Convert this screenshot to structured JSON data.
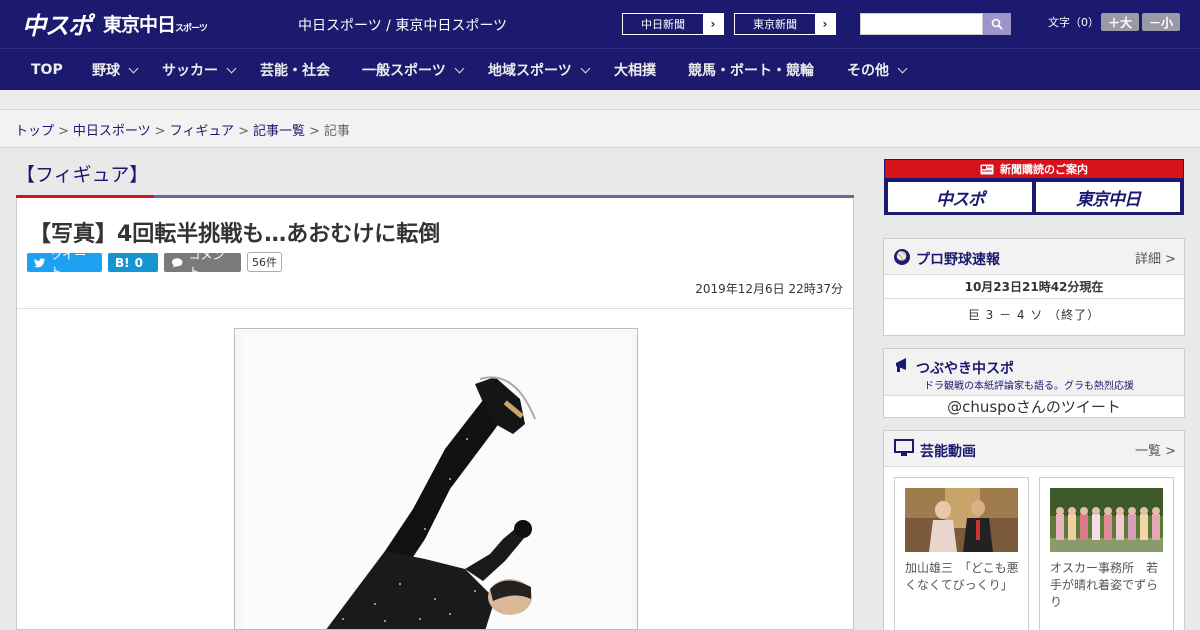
{
  "header": {
    "logo_chuspo": "中スポ",
    "logo_tokyo": "東京中日",
    "logo_tokyo_small": "スポーツ",
    "site_title": "中日スポーツ / 東京中日スポーツ",
    "paper_links": [
      {
        "label": "中日新聞",
        "arrow": "›"
      },
      {
        "label": "東京新聞",
        "arrow": "›"
      }
    ],
    "search_placeholder": "",
    "font_size_label": "文字（0）",
    "font_bigger": "＋大",
    "font_smaller": "－小"
  },
  "nav": [
    {
      "label": "TOP",
      "has_menu": false
    },
    {
      "label": "野球",
      "has_menu": true
    },
    {
      "label": "サッカー",
      "has_menu": true
    },
    {
      "label": "芸能・社会",
      "has_menu": false
    },
    {
      "label": "一般スポーツ",
      "has_menu": true
    },
    {
      "label": "地域スポーツ",
      "has_menu": true
    },
    {
      "label": "大相撲",
      "has_menu": false
    },
    {
      "label": "競馬・ボート・競輪",
      "has_menu": false
    },
    {
      "label": "その他",
      "has_menu": true
    }
  ],
  "breadcrumb": {
    "items": [
      "トップ",
      "中日スポーツ",
      "フィギュア",
      "記事一覧"
    ],
    "current": "記事",
    "separator": ">"
  },
  "category": "【フィギュア】",
  "article": {
    "title": "【写真】4回転半挑戦も…あおむけに転倒",
    "tweet_label": "ツイート",
    "hatena_label": "B!",
    "hatena_count": "0",
    "comment_label": "コメント",
    "comment_count": "56件",
    "timestamp": "2019年12月6日 22時37分"
  },
  "sidebar": {
    "subscribe_title": "新聞購読のご案内",
    "subscribe_logo_1": "中スポ",
    "subscribe_logo_2": "東京中日",
    "baseball": {
      "title": "プロ野球速報",
      "more": "詳細 >",
      "time": "10月23日21時42分現在",
      "score": "巨 3 － 4 ソ （終了）"
    },
    "tsubuyaki": {
      "title": "つぶやき中スポ",
      "subtitle": "ドラ観戦の本紙評論家も語る。グラも熱烈応援",
      "tweet_link": "@chuspoさんのツイート"
    },
    "videos": {
      "title": "芸能動画",
      "more": "一覧 >",
      "items": [
        {
          "caption": "加山雄三　「どこも悪くなくてびっくり」"
        },
        {
          "caption": "オスカー事務所　若手が晴れ着姿でずらり"
        }
      ]
    }
  },
  "colors": {
    "brand_navy": "#1b1a6e",
    "accent_red": "#d7121d",
    "twitter_blue": "#1da1f2",
    "hatena_blue": "#1794d2"
  }
}
